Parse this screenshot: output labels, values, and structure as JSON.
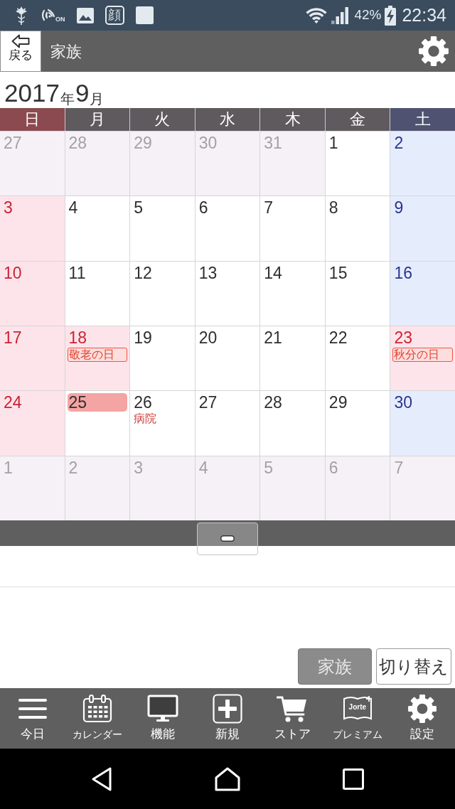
{
  "status_bar": {
    "icons": [
      {
        "kind": "ornament"
      },
      {
        "kind": "nfc",
        "text": "ON"
      },
      {
        "kind": "image"
      },
      {
        "kind": "glyph",
        "text": "顔"
      },
      {
        "kind": "square"
      }
    ],
    "battery": "42%",
    "time": "22:34"
  },
  "header": {
    "back_label": "戻る",
    "title": "家族"
  },
  "month_title": {
    "year": "2017",
    "year_unit": "年",
    "month": "9",
    "month_unit": "月"
  },
  "calendar": {
    "weekdays": [
      {
        "label": "日",
        "kind": "sunday"
      },
      {
        "label": "月",
        "kind": "weekday"
      },
      {
        "label": "火",
        "kind": "weekday"
      },
      {
        "label": "水",
        "kind": "weekday"
      },
      {
        "label": "木",
        "kind": "weekday"
      },
      {
        "label": "金",
        "kind": "weekday"
      },
      {
        "label": "土",
        "kind": "saturday"
      }
    ],
    "weeks": [
      [
        {
          "day": "27",
          "kind": "other",
          "today": false
        },
        {
          "day": "28",
          "kind": "other",
          "today": false
        },
        {
          "day": "29",
          "kind": "other",
          "today": false
        },
        {
          "day": "30",
          "kind": "other",
          "today": false
        },
        {
          "day": "31",
          "kind": "other",
          "today": false
        },
        {
          "day": "1",
          "kind": "weekday",
          "today": false
        },
        {
          "day": "2",
          "kind": "saturday",
          "today": false
        }
      ],
      [
        {
          "day": "3",
          "kind": "sunday",
          "today": false
        },
        {
          "day": "4",
          "kind": "weekday",
          "today": false
        },
        {
          "day": "5",
          "kind": "weekday",
          "today": false
        },
        {
          "day": "6",
          "kind": "weekday",
          "today": false
        },
        {
          "day": "7",
          "kind": "weekday",
          "today": false
        },
        {
          "day": "8",
          "kind": "weekday",
          "today": false
        },
        {
          "day": "9",
          "kind": "saturday",
          "today": false
        }
      ],
      [
        {
          "day": "10",
          "kind": "sunday",
          "today": false
        },
        {
          "day": "11",
          "kind": "weekday",
          "today": false
        },
        {
          "day": "12",
          "kind": "weekday",
          "today": false
        },
        {
          "day": "13",
          "kind": "weekday",
          "today": false
        },
        {
          "day": "14",
          "kind": "weekday",
          "today": false
        },
        {
          "day": "15",
          "kind": "weekday",
          "today": false
        },
        {
          "day": "16",
          "kind": "saturday",
          "today": false
        }
      ],
      [
        {
          "day": "17",
          "kind": "sunday",
          "today": false
        },
        {
          "day": "18",
          "kind": "holiday",
          "today": false,
          "events": [
            {
              "text": "敬老の日",
              "kind": "holiday"
            }
          ]
        },
        {
          "day": "19",
          "kind": "weekday",
          "today": false
        },
        {
          "day": "20",
          "kind": "weekday",
          "today": false
        },
        {
          "day": "21",
          "kind": "weekday",
          "today": false
        },
        {
          "day": "22",
          "kind": "weekday",
          "today": false
        },
        {
          "day": "23",
          "kind": "holiday",
          "today": false,
          "events": [
            {
              "text": "秋分の日",
              "kind": "holiday"
            }
          ]
        }
      ],
      [
        {
          "day": "24",
          "kind": "sunday",
          "today": false
        },
        {
          "day": "25",
          "kind": "weekday",
          "today": true
        },
        {
          "day": "26",
          "kind": "weekday",
          "today": false,
          "events": [
            {
              "text": "病院",
              "kind": "plain"
            }
          ]
        },
        {
          "day": "27",
          "kind": "weekday",
          "today": false
        },
        {
          "day": "28",
          "kind": "weekday",
          "today": false
        },
        {
          "day": "29",
          "kind": "weekday",
          "today": false
        },
        {
          "day": "30",
          "kind": "saturday",
          "today": false
        }
      ],
      [
        {
          "day": "1",
          "kind": "other",
          "today": false
        },
        {
          "day": "2",
          "kind": "other",
          "today": false
        },
        {
          "day": "3",
          "kind": "other",
          "today": false
        },
        {
          "day": "4",
          "kind": "other",
          "today": false
        },
        {
          "day": "5",
          "kind": "other",
          "today": false
        },
        {
          "day": "6",
          "kind": "other",
          "today": false
        },
        {
          "day": "7",
          "kind": "other",
          "today": false
        }
      ]
    ]
  },
  "buttons": [
    {
      "label": "家族",
      "kind": "filled"
    },
    {
      "label": "切り替え",
      "kind": "outline"
    }
  ],
  "toolbar": [
    {
      "label": "今日",
      "kind": "menu"
    },
    {
      "label": "カレンダー",
      "kind": "calendar"
    },
    {
      "label": "機能",
      "kind": "monitor"
    },
    {
      "label": "新規",
      "kind": "plus"
    },
    {
      "label": "ストア",
      "kind": "cart"
    },
    {
      "label": "プレミアム",
      "kind": "book",
      "icon_text": "Jorte"
    },
    {
      "label": "設定",
      "kind": "gear"
    }
  ]
}
